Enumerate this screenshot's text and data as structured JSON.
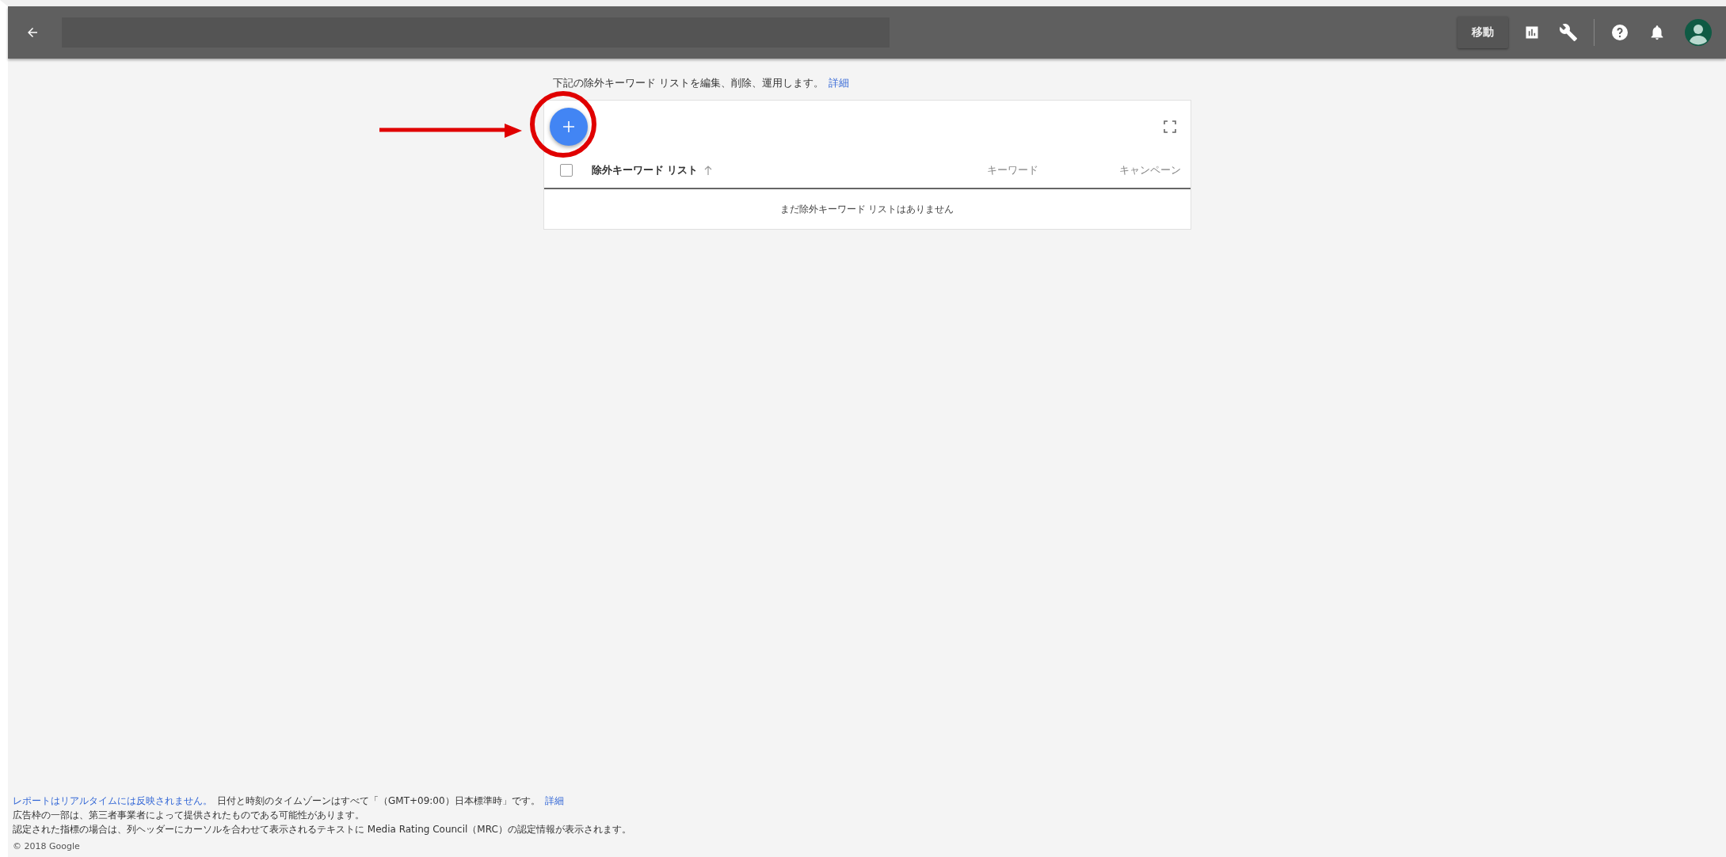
{
  "top_bar": {
    "go_button": "移動"
  },
  "intro": {
    "text": "下記の除外キーワード リストを編集、削除、運用します。",
    "link": "詳細"
  },
  "table": {
    "select_all_checked": false,
    "columns": [
      {
        "label": "除外キーワード リスト",
        "sorted": true
      },
      {
        "label": "キーワード",
        "sorted": false
      },
      {
        "label": "キャンペーン",
        "sorted": false
      }
    ],
    "empty_message": "まだ除外キーワード リストはありません"
  },
  "annotation": {
    "highlight_add_button": true
  },
  "footer": {
    "lines": [
      {
        "link": "レポートはリアルタイムには反映されません。",
        "text": "日付と時刻のタイムゾーンはすべて「（GMT+09:00）日本標準時」です。",
        "trailing_link": "詳細"
      },
      {
        "text": "広告枠の一部は、第三者事業者によって提供されたものである可能性があります。"
      },
      {
        "text": "認定された指標の場合は、列ヘッダーにカーソルを合わせて表示されるテキストに Media Rating Council（MRC）の認定情報が表示されます。"
      }
    ],
    "copyright": "© 2018 Google"
  }
}
